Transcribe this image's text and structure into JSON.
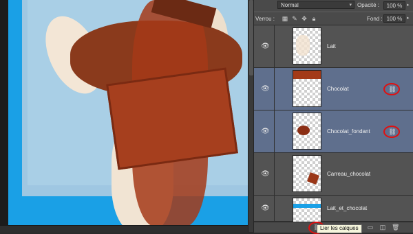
{
  "options": {
    "blend_mode": "Normal",
    "opacity_label": "Opacité :",
    "opacity_value": "100 %",
    "lock_label": "Verrou :",
    "fill_label": "Fond :",
    "fill_value": "100 %"
  },
  "layers": [
    {
      "name": "Lait",
      "selected": false,
      "linked": false
    },
    {
      "name": "Chocolat",
      "selected": true,
      "linked": true
    },
    {
      "name": "Chocolat_fondant",
      "selected": true,
      "linked": true
    },
    {
      "name": "Carreau_chocolat",
      "selected": false,
      "linked": false
    },
    {
      "name": "Lait_et_chocolat",
      "selected": false,
      "linked": false
    }
  ],
  "tooltip": "Lier les calques",
  "colors": {
    "highlight": "#e01010",
    "selected_row": "#5f6f8d",
    "canvas_blue": "#1aa0e6"
  },
  "icons": [
    "eye-icon",
    "link-icon",
    "lock-icon",
    "fx-icon",
    "mask-icon",
    "folder-icon",
    "new-layer-icon",
    "trash-icon"
  ]
}
